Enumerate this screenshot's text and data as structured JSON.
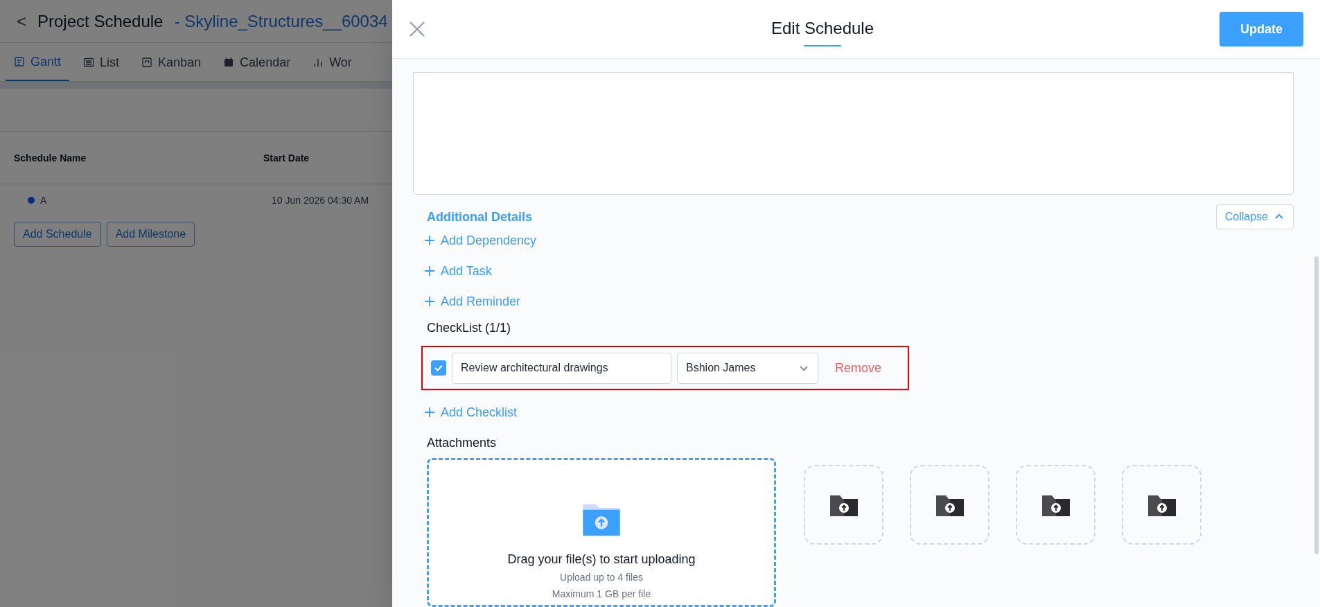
{
  "page": {
    "back": "<",
    "title": "Project Schedule",
    "project": "- Skyline_Structures__60034",
    "tabs": [
      {
        "label": "Gantt",
        "kind": "gantt",
        "selected": true
      },
      {
        "label": "List",
        "kind": "list",
        "selected": false
      },
      {
        "label": "Kanban",
        "kind": "kanban",
        "selected": false
      },
      {
        "label": "Calendar",
        "kind": "calendar",
        "selected": false
      },
      {
        "label": "Wor",
        "kind": "chart",
        "selected": false
      }
    ],
    "table": {
      "columns": [
        "Schedule Name",
        "Start Date"
      ],
      "rows": [
        {
          "name": "A",
          "start": "10 Jun 2026 04:30 AM",
          "color": "#0a2a7a"
        }
      ]
    },
    "buttons": [
      "Add Schedule",
      "Add Milestone"
    ]
  },
  "drawer": {
    "title": "Edit Schedule",
    "update": "Update",
    "section": "Additional Details",
    "collapse": "Collapse",
    "expanded": true,
    "adds": [
      "Add Dependency",
      "Add Task",
      "Add Reminder"
    ],
    "checklist": {
      "title": "CheckList (1/1)",
      "items": [
        {
          "text": "Review architectural drawings",
          "assignee": "Bshion James",
          "checked": true,
          "remove": "Remove"
        }
      ],
      "add": "Add Checklist"
    },
    "attachments": {
      "title": "Attachments",
      "drop": "Drag your file(s) to start uploading",
      "hints": [
        "Upload up to 4 files",
        "Maximum 1 GB per file"
      ]
    }
  }
}
